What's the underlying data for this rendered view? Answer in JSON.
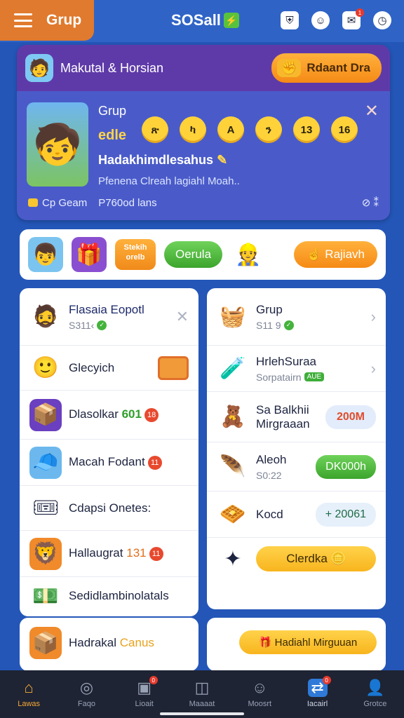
{
  "header": {
    "tab_title": "Grup",
    "brand": "SOSall",
    "notif_badge": "1"
  },
  "promo": {
    "head_label": "Makutal & Horsian",
    "head_button": "Rdaant Dra",
    "title": "Grup",
    "subtitle": "edle",
    "balls": [
      "ጽ",
      "ካ",
      "A",
      "ን",
      "13",
      "16"
    ],
    "line3": "Hadakhimdlesahus",
    "line4": "Pfenena Clreah lagiahl Moah..",
    "foot_left": "Cp Geam",
    "foot_mid": "P760od lans",
    "foot_right": "⊘ ⁑"
  },
  "strip": {
    "badge": "Stekih orelb",
    "green_btn": "Oerula",
    "orange_btn": "Rajiavh"
  },
  "left_list": [
    {
      "title": "Flasaia Eopotl",
      "sub": "S311‹"
    },
    {
      "title": "Glecyich"
    },
    {
      "title": "Dlasolkar",
      "num": "601",
      "badge": "18"
    },
    {
      "title": "Macah Fodant",
      "badge": "11"
    },
    {
      "title": "Cdapsi Onetes:"
    },
    {
      "title": "Hallaugrat",
      "num": "131",
      "badge": "11"
    },
    {
      "title": "Sedidlambinolatals"
    }
  ],
  "right_list": [
    {
      "title": "Grup",
      "sub": "S11 9"
    },
    {
      "title": "HrlehSuraa",
      "sub": "Sorpatairn",
      "tag": "AUE"
    },
    {
      "title": "Sa Balkhii Mirgraaan",
      "pill": "200M"
    },
    {
      "title": "Aleoh",
      "sub": "S0:22",
      "pill": "DK000h"
    },
    {
      "title": "Kocd",
      "pill": "+ 20061"
    },
    {
      "title": "",
      "pill": "Clerdka"
    }
  ],
  "bottom_left": {
    "title": "Hadrakal",
    "accent": "Canus"
  },
  "bottom_right": {
    "button": "Hadiahl Mirguuan"
  },
  "nav": [
    {
      "label": "Lawas",
      "icon": "home-icon"
    },
    {
      "label": "Faqo",
      "icon": "compass-icon"
    },
    {
      "label": "Lioait",
      "icon": "bag-icon",
      "badge": "0"
    },
    {
      "label": "Maaaat",
      "icon": "chat-icon"
    },
    {
      "label": "Moosrt",
      "icon": "face-icon"
    },
    {
      "label": "Iacairl",
      "icon": "store-icon",
      "badge": "0"
    },
    {
      "label": "Grotce",
      "icon": "profile-icon"
    }
  ],
  "colors": {
    "accent_orange": "#f58a16",
    "accent_green": "#3ca52c",
    "primary_blue": "#2456b8",
    "promo_purple": "#5e3aa8"
  }
}
